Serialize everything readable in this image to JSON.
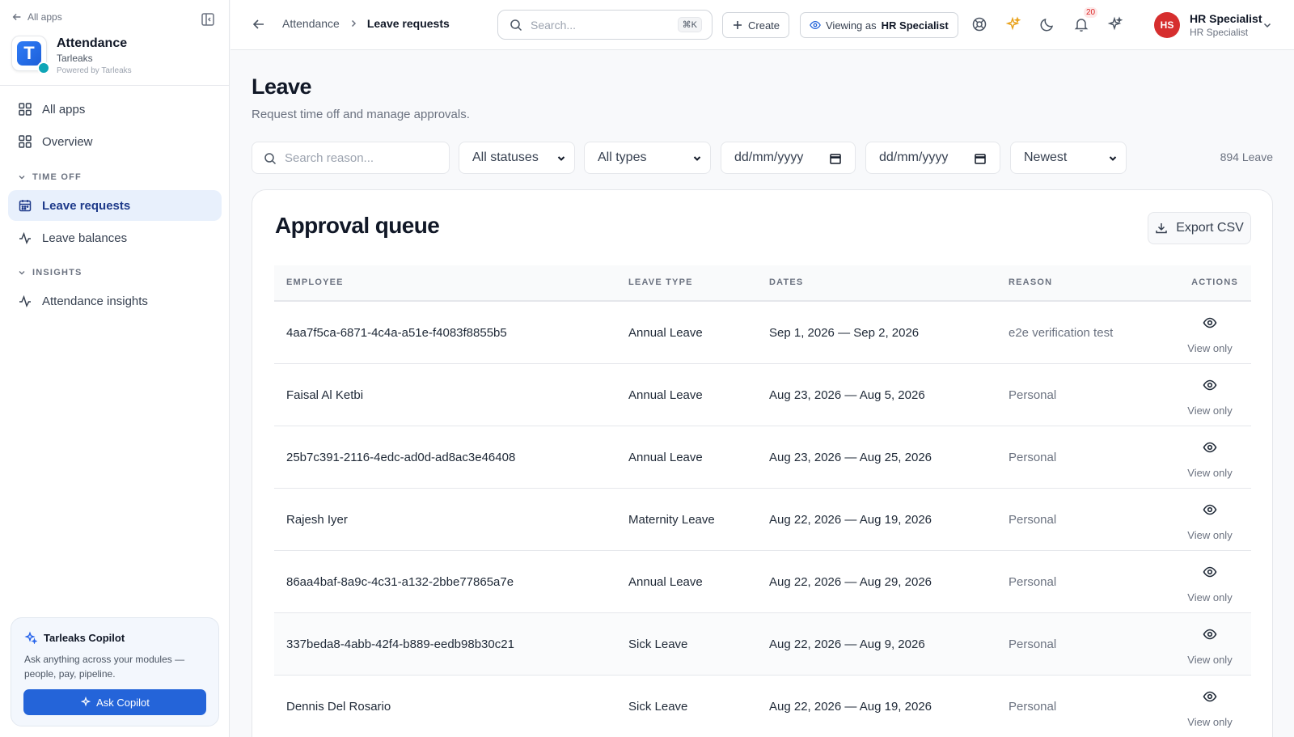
{
  "sidebar": {
    "back_label": "All apps",
    "app_title": "Attendance",
    "app_org": "Tarleaks",
    "app_powered": "Powered by Tarleaks",
    "app_logo_letter": "T",
    "nav": {
      "all_apps": "All apps",
      "overview": "Overview",
      "section_time_off": "TIME OFF",
      "leave_requests": "Leave requests",
      "leave_balances": "Leave balances",
      "section_insights": "INSIGHTS",
      "attendance_insights": "Attendance insights"
    },
    "copilot": {
      "title": "Tarleaks Copilot",
      "description": "Ask anything across your modules — people, pay, pipeline.",
      "button": "Ask Copilot"
    }
  },
  "topbar": {
    "breadcrumb": [
      "Attendance",
      "Leave requests"
    ],
    "search_placeholder": "Search...",
    "search_shortcut": "⌘K",
    "create_label": "Create",
    "viewing_as_prefix": "Viewing as",
    "viewing_as_role": "HR Specialist",
    "notification_count": "20",
    "user_initials": "HS",
    "user_name": "HR Specialist",
    "user_role": "HR Specialist"
  },
  "page": {
    "title": "Leave",
    "subtitle": "Request time off and manage approvals."
  },
  "filters": {
    "search_placeholder": "Search reason...",
    "status": "All statuses",
    "type": "All types",
    "date_from": "dd/mm/yyyy",
    "date_to": "dd/mm/yyyy",
    "sort": "Newest",
    "count": "894 Leave"
  },
  "queue": {
    "title": "Approval queue",
    "export_label": "Export CSV",
    "columns": [
      "EMPLOYEE",
      "LEAVE TYPE",
      "DATES",
      "REASON",
      "ACTIONS"
    ],
    "action_label": "View only",
    "rows": [
      {
        "employee": "4aa7f5ca-6871-4c4a-a51e-f4083f8855b5",
        "type": "Annual Leave",
        "dates": "Sep 1, 2026 — Sep 2, 2026",
        "reason": "e2e verification test"
      },
      {
        "employee": "Faisal Al Ketbi",
        "type": "Annual Leave",
        "dates": "Aug 23, 2026 — Aug 5, 2026",
        "reason": "Personal"
      },
      {
        "employee": "25b7c391-2116-4edc-ad0d-ad8ac3e46408",
        "type": "Annual Leave",
        "dates": "Aug 23, 2026 — Aug 25, 2026",
        "reason": "Personal"
      },
      {
        "employee": "Rajesh Iyer",
        "type": "Maternity Leave",
        "dates": "Aug 22, 2026 — Aug 19, 2026",
        "reason": "Personal"
      },
      {
        "employee": "86aa4baf-8a9c-4c31-a132-2bbe77865a7e",
        "type": "Annual Leave",
        "dates": "Aug 22, 2026 — Aug 29, 2026",
        "reason": "Personal"
      },
      {
        "employee": "337beda8-4abb-42f4-b889-eedb98b30c21",
        "type": "Sick Leave",
        "dates": "Aug 22, 2026 — Aug 9, 2026",
        "reason": "Personal"
      },
      {
        "employee": "Dennis Del Rosario",
        "type": "Sick Leave",
        "dates": "Aug 22, 2026 — Aug 19, 2026",
        "reason": "Personal"
      }
    ]
  },
  "colors": {
    "accent": "#2464d9",
    "active_nav_bg": "#e8f0fc",
    "avatar": "#d62e2e"
  }
}
